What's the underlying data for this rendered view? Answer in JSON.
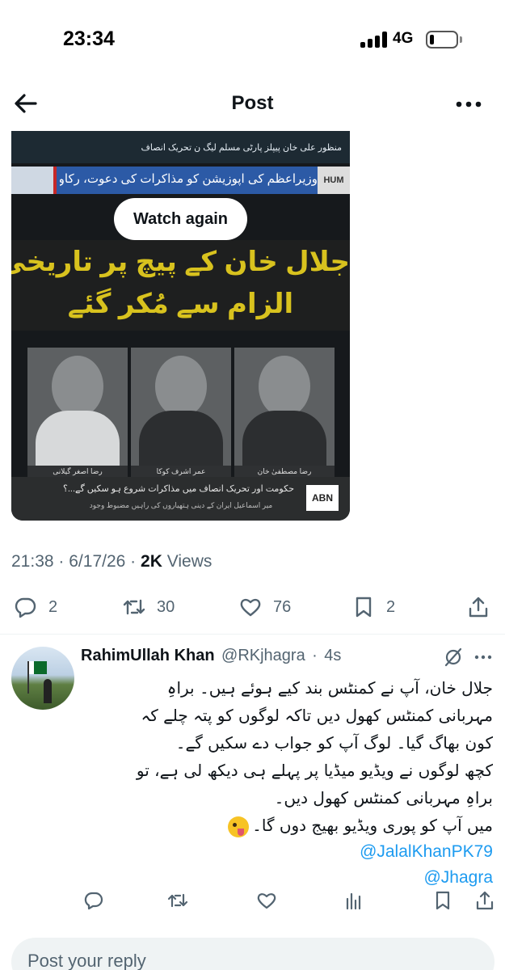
{
  "status_bar": {
    "time": "23:34",
    "network": "4G",
    "battery_level": 0.15
  },
  "header": {
    "title": "Post",
    "back_icon": "arrow-left-icon",
    "more_icon": "more-horizontal-icon"
  },
  "video": {
    "watch_again_label": "Watch again",
    "overlay": {
      "top_bar": "منظور علی خان    پیپلز پارٹی    مسلم لیگ ن    تحریک انصاف",
      "ticker": "وزیراعظم کی اپوزیشن کو مذاکرات کی دعوت، رکاوٹ کہاں؟",
      "ticker_badge": "HUM",
      "headline_line1": "جلال خان کے پیچ پر تاریخی یوٹرن",
      "headline_line2": "الزام سے مُکر گئے",
      "panel_captions": [
        "رضا اصغر گیلانی",
        "عمر اشرف کوکا",
        "رضا مصطفیٰ خان"
      ],
      "lower_third": "حکومت اور تحریک انصاف میں مذاکرات شروع ہو سکیں گے...؟",
      "lower_sub": "میر اسماعیل ایران کے دینی ہتھیاروں کی راہیں مضبوط وجود",
      "channel_badge": "ABN"
    }
  },
  "meta": {
    "time": "21:38",
    "separator": "·",
    "date": "6/17/26",
    "separator2": "·",
    "views_count": "2K",
    "views_label": "Views"
  },
  "actions": {
    "replies": "2",
    "reposts": "30",
    "likes": "76",
    "bookmarks": "2"
  },
  "reply": {
    "name": "RahimUllah Khan",
    "handle": "@RKjhagra",
    "separator": "·",
    "time": "4s",
    "lines": [
      "جلال خان، آپ نے کمنٹس بند کیے ہوئے ہیں۔ براہِ",
      "مہربانی کمنٹس کھول دیں تاکہ لوگوں کو پتہ چلے کہ",
      "کون بھاگ گیا۔ لوگ آپ کو جواب دے سکیں گے۔",
      "کچھ لوگوں نے ویڈیو میڈیا پر پہلے ہی دیکھ لی ہے، تو",
      "براہِ مہربانی کمنٹس کھول دیں۔",
      "میں آپ کو پوری ویڈیو بھیج دوں گا۔"
    ],
    "emoji": "winking-face-with-tongue",
    "mentions": [
      "@JalalKhanPK79",
      "@Jhagra"
    ]
  },
  "compose": {
    "placeholder": "Post your reply"
  }
}
